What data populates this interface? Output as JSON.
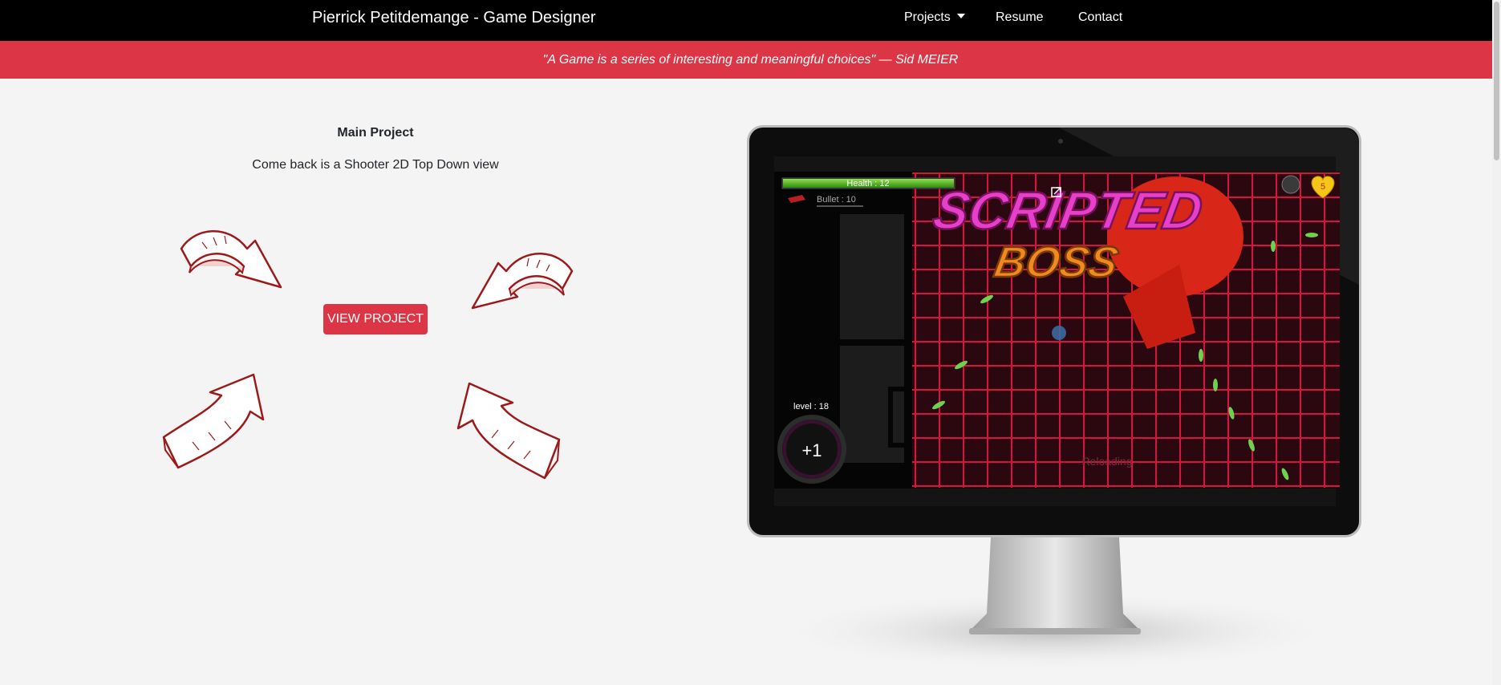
{
  "navbar": {
    "brand": "Pierrick Petitdemange - Game Designer",
    "links": [
      {
        "label": "Projects",
        "has_dropdown": true
      },
      {
        "label": "Resume"
      },
      {
        "label": "Contact"
      }
    ]
  },
  "banner": {
    "quote": "\"A Game is a series of interesting and meaningful choices\" — Sid MEIER"
  },
  "main_project": {
    "title": "Main Project",
    "description": "Come back is a Shooter 2D Top Down view",
    "button_label": "VIEW PROJECT"
  },
  "game_screen": {
    "health": "Health : 12",
    "bullet": "Bullet : 10",
    "title_line1": "SCRIPTED",
    "title_line2": "BOSS",
    "level": "level : 18",
    "combo": "+1",
    "status": "Reloading",
    "lives": "5"
  },
  "colors": {
    "accent": "#dc3545",
    "navbar_bg": "#000000",
    "page_bg": "#f4f4f4"
  }
}
